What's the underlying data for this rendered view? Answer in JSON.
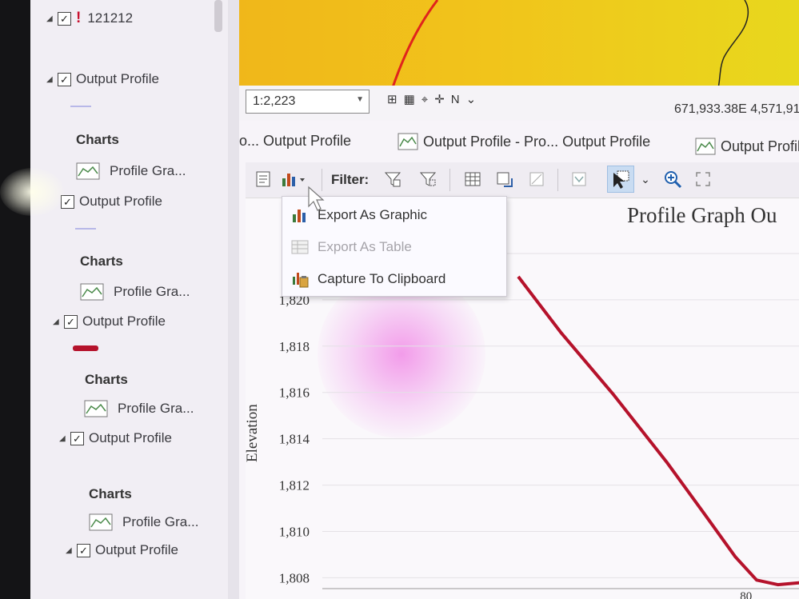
{
  "contents": {
    "layers": [
      {
        "name": "121212",
        "warning": "!"
      },
      {
        "name": "Output Profile"
      },
      {
        "name": "Output Profile"
      },
      {
        "name": "Output Profile"
      },
      {
        "name": "Output Profile"
      },
      {
        "name": "Output Profile"
      }
    ],
    "charts_heading": "Charts",
    "chart_item": "Profile Gra..."
  },
  "statusbar": {
    "scale": "1:2,223",
    "coordinates": "671,933.38E 4,571,91"
  },
  "tabs": [
    "o... Output Profile",
    "Output Profile - Pro... Output Profile",
    "Output Profil"
  ],
  "toolbar": {
    "filter_label": "Filter:"
  },
  "export_menu": {
    "items": [
      {
        "label": "Export As Graphic",
        "enabled": true
      },
      {
        "label": "Export As Table",
        "enabled": false
      },
      {
        "label": "Capture To Clipboard",
        "enabled": true
      }
    ]
  },
  "chart_data": {
    "type": "line",
    "title": "Profile Graph Ou",
    "ylabel": "Elevation",
    "xlabel": "",
    "yticks": [
      "1,",
      "1,820",
      "1,818",
      "1,816",
      "1,814",
      "1,812",
      "1,810",
      "1,808"
    ],
    "xticks": [
      "80"
    ],
    "ylim": [
      1807.6,
      1823
    ],
    "series": [
      {
        "color": "#b5122b",
        "points": [
          [
            37,
            1821.0
          ],
          [
            45,
            1818.6
          ],
          [
            55,
            1815.9
          ],
          [
            65,
            1813.0
          ],
          [
            72,
            1810.8
          ],
          [
            78,
            1808.9
          ],
          [
            82,
            1807.9
          ],
          [
            86,
            1807.7
          ],
          [
            91,
            1807.8
          ]
        ]
      }
    ]
  },
  "colors": {
    "map_fill": "#f0b71a",
    "profile_line": "#b5122b",
    "selected_button": "#c9dcf2"
  }
}
